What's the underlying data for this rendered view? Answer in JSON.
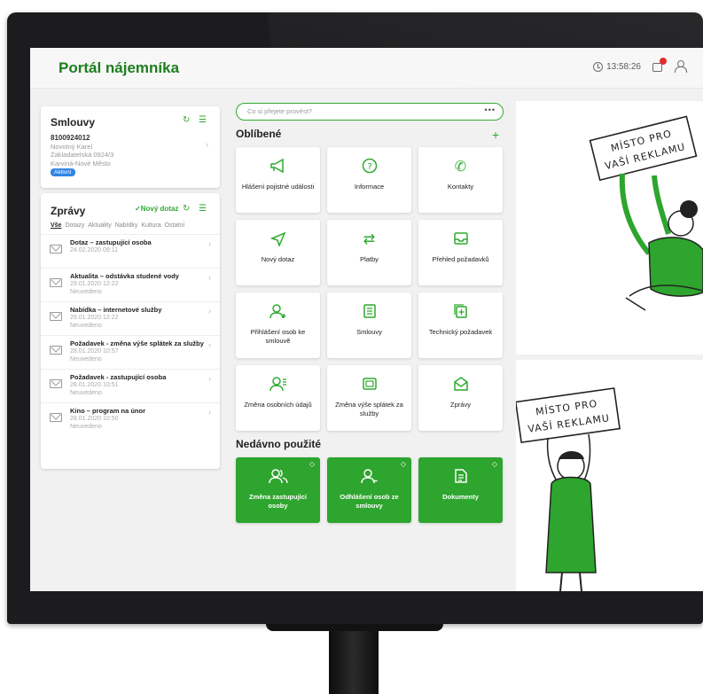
{
  "header": {
    "title": "Portál nájemníka",
    "time": "13:58:26"
  },
  "contracts": {
    "title": "Smlouvy",
    "number": "8100924012",
    "name": "Novotný Karel",
    "street": "Zakladatelská 0924/3",
    "city": "Karviná-Nové Město",
    "badge": "Aktivní"
  },
  "messages": {
    "title": "Zprávy",
    "new_query": "Nový dotaz",
    "filters": [
      "Vše",
      "Dotazy",
      "Aktuality",
      "Nabídky",
      "Kultura",
      "Ostatní"
    ],
    "items": [
      {
        "title": "Dotaz – zastupující osoba",
        "date": "24.02.2020 09:11",
        "status": ""
      },
      {
        "title": "Aktualita – odstávka studené vody",
        "date": "29.01.2020 12:22",
        "status": "Neuvedeno"
      },
      {
        "title": "Nabídka – internetové služby",
        "date": "29.01.2020 12:22",
        "status": "Neuvedeno"
      },
      {
        "title": "Požadavek - změna výše splátek za služby",
        "date": "28.01.2020 10:57",
        "status": "Neuvedeno"
      },
      {
        "title": "Požadavek - zastupující osoba",
        "date": "28.01.2020 10:51",
        "status": "Neuvedeno"
      },
      {
        "title": "Kino – program na únor",
        "date": "28.01.2020 10:50",
        "status": "Neuvedeno"
      }
    ]
  },
  "search": {
    "placeholder": "Co si přejete provést?"
  },
  "favorites": {
    "title": "Oblíbené",
    "tiles": [
      {
        "label": "Hlášení pojistné události",
        "icon": "megaphone-icon"
      },
      {
        "label": "Informace",
        "icon": "question-icon"
      },
      {
        "label": "Kontakty",
        "icon": "phone-icon"
      },
      {
        "label": "Nový dotaz",
        "icon": "send-icon"
      },
      {
        "label": "Platby",
        "icon": "transfer-icon"
      },
      {
        "label": "Přehled požadavků",
        "icon": "inbox-icon"
      },
      {
        "label": "Přihlášení osob ke smlouvě",
        "icon": "add-person-icon"
      },
      {
        "label": "Smlouvy",
        "icon": "document-list-icon"
      },
      {
        "label": "Technický požadavek",
        "icon": "add-document-icon"
      },
      {
        "label": "Změna osobních údajů",
        "icon": "person-edit-icon"
      },
      {
        "label": "Změna výše splátek za služby",
        "icon": "money-icon"
      },
      {
        "label": "Zprávy",
        "icon": "envelope-icon"
      }
    ]
  },
  "recent": {
    "title": "Nedávno použité",
    "tiles": [
      {
        "label": "Změna zastupující osoby",
        "icon": "people-icon"
      },
      {
        "label": "Odhlášení osob ze smlouvy",
        "icon": "remove-person-icon"
      },
      {
        "label": "Dokumenty",
        "icon": "document-icon"
      }
    ]
  },
  "ads": {
    "line1": "MÍSTO PRO",
    "line2": "VAŠÍ REKLAMU"
  },
  "colors": {
    "brand_green": "#2ea52e",
    "title_green": "#1e7e1e",
    "badge_blue": "#2f86e6",
    "notification_red": "#e02323"
  }
}
